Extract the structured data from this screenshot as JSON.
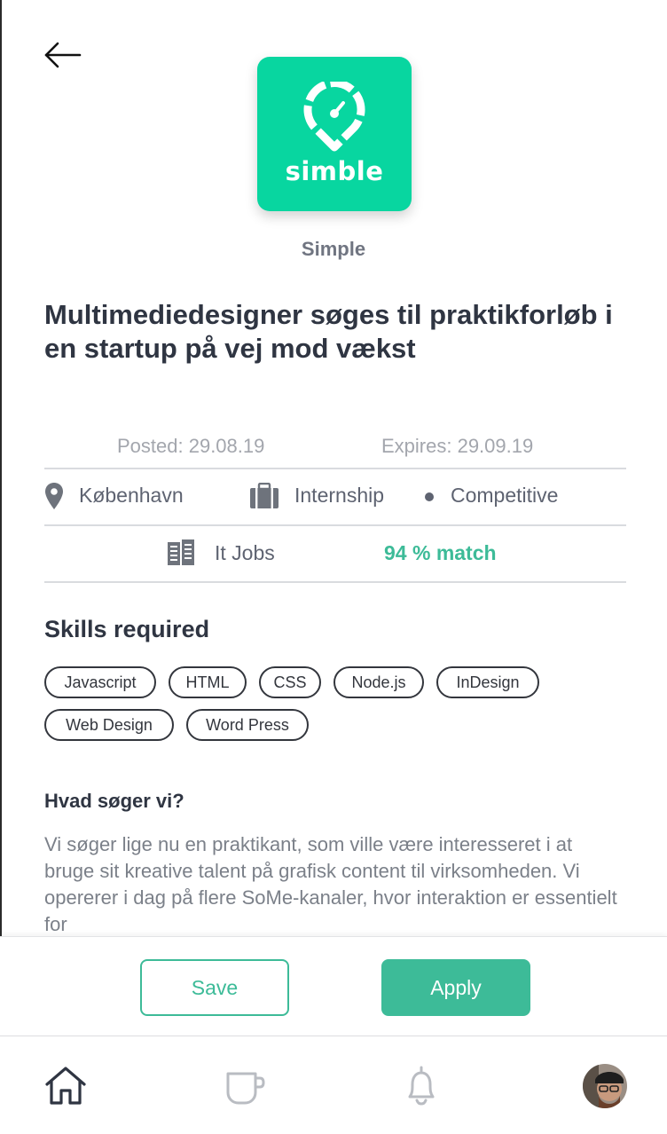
{
  "company": {
    "logo_text": "simble",
    "name": "Simple"
  },
  "job": {
    "title": "Multimediedesigner søges til praktikforløb i en startup på vej mod vækst",
    "posted": "Posted: 29.08.19",
    "expires": "Expires: 29.09.19",
    "location": "København",
    "type": "Internship",
    "salary": "Competitive",
    "category": "It Jobs",
    "match": "94 % match"
  },
  "skills": {
    "title": "Skills required",
    "items": [
      "Javascript",
      "HTML",
      "CSS",
      "Node.js",
      "InDesign",
      "Web Design",
      "Word Press"
    ]
  },
  "section": {
    "title": "Hvad søger vi?",
    "body": "Vi søger lige nu en praktikant, som ville være interesseret i at bruge sit kreative talent på grafisk content til virksomheden. Vi opererer i dag på flere SoMe-kanaler, hvor interaktion er essentielt for"
  },
  "actions": {
    "save": "Save",
    "apply": "Apply"
  },
  "tabs": [
    {
      "icon": "home-icon"
    },
    {
      "icon": "mug-icon"
    },
    {
      "icon": "bell-icon"
    },
    {
      "icon": "avatar"
    }
  ],
  "colors": {
    "brand": "#08d6a0",
    "accent": "#3dbb98",
    "text": "#2f3542",
    "muted": "#a3a6ad"
  }
}
